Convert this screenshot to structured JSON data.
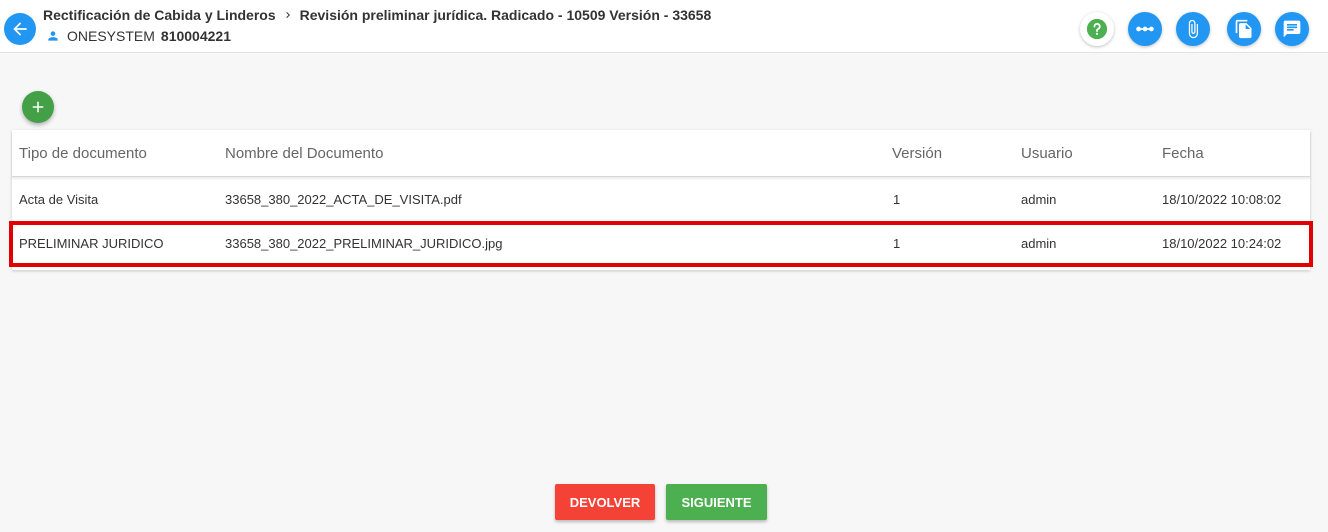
{
  "header": {
    "breadcrumb_parent": "Rectificación de Cabida y Linderos",
    "breadcrumb_current": "Revisión preliminar jurídica. Radicado - 10509 Versión - 33658",
    "user_name": "ONESYSTEM",
    "user_id": "810004221",
    "icons": [
      "arrow-left-icon",
      "help-icon",
      "workflow-icon",
      "attachment-icon",
      "documents-icon",
      "comments-icon"
    ]
  },
  "table": {
    "columns": [
      "Tipo de documento",
      "Nombre del Documento",
      "Versión",
      "Usuario",
      "Fecha"
    ],
    "rows": [
      {
        "tipo": "Acta de Visita",
        "nombre": "33658_380_2022_ACTA_DE_VISITA.pdf",
        "version": "1",
        "usuario": "admin",
        "fecha": "18/10/2022 10:08:02"
      },
      {
        "tipo": "PRELIMINAR JURIDICO",
        "nombre": "33658_380_2022_PRELIMINAR_JURIDICO.jpg",
        "version": "1",
        "usuario": "admin",
        "fecha": "18/10/2022 10:24:02"
      }
    ]
  },
  "footer": {
    "devolver_label": "DEVOLVER",
    "siguiente_label": "SIGUIENTE"
  },
  "colors": {
    "primary": "#2196f3",
    "add": "#43a047",
    "devolver": "#f44336",
    "siguiente": "#4caf50",
    "highlight": "#e00000"
  }
}
